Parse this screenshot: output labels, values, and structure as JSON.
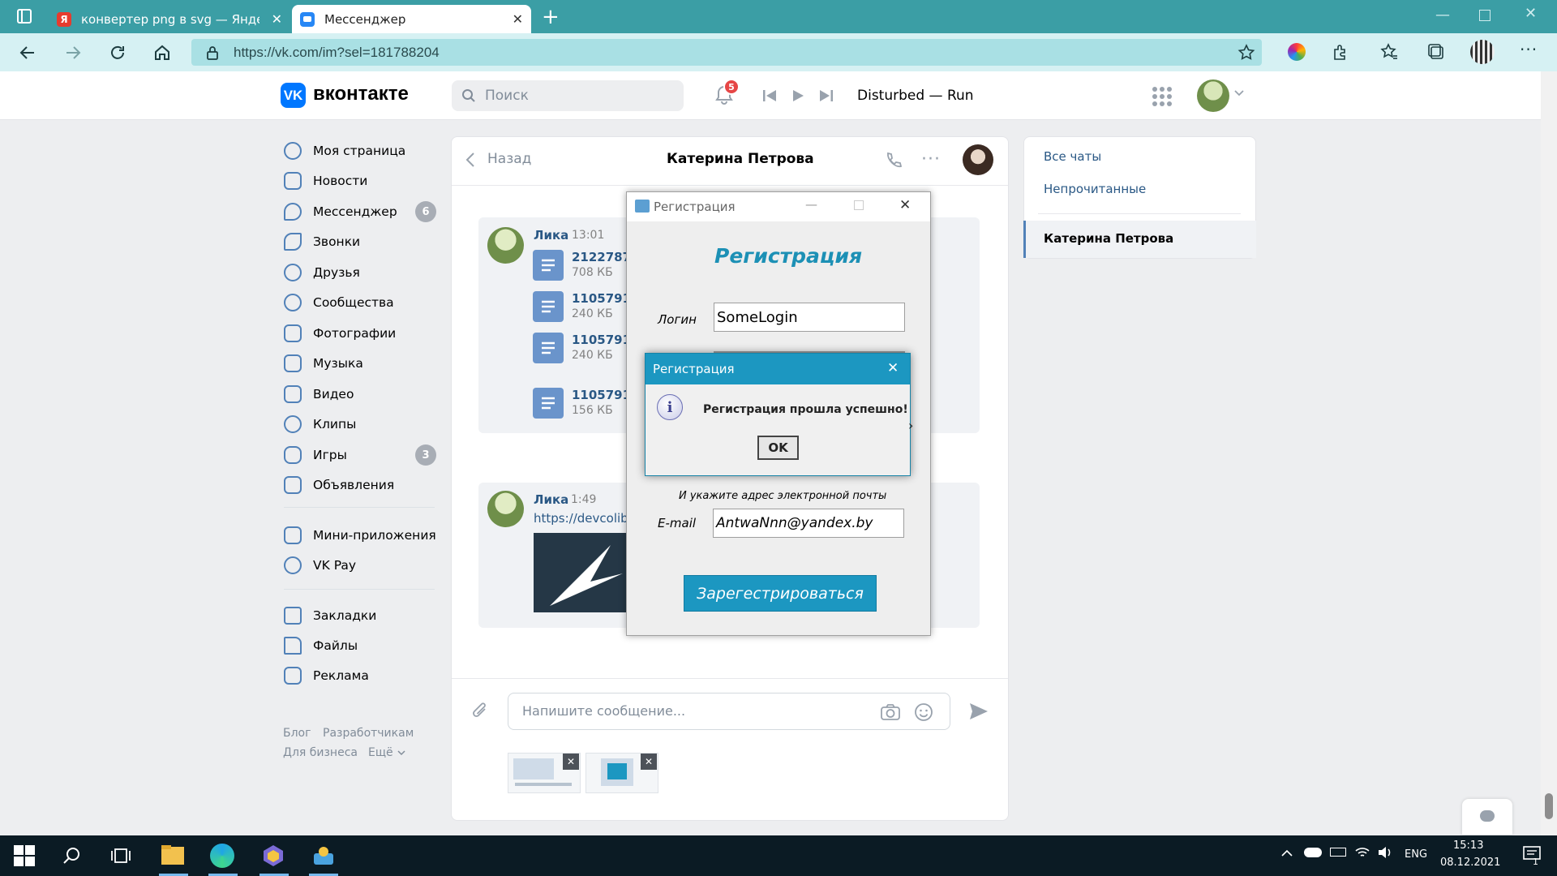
{
  "browser": {
    "tabs": [
      {
        "label": "конвертер png в svg — Яндекс",
        "favicon": "Я"
      },
      {
        "label": "Мессенджер",
        "favicon": "chat"
      }
    ],
    "url": "https://vk.com/im?sel=181788204"
  },
  "vk": {
    "logo_text": "вконтакте",
    "search_placeholder": "Поиск",
    "notifications_count": "5",
    "now_playing": "Disturbed — Run",
    "nav": [
      {
        "label": "Моя страница",
        "icon": "user-circle-icon"
      },
      {
        "label": "Новости",
        "icon": "news-icon"
      },
      {
        "label": "Мессенджер",
        "icon": "message-icon",
        "badge": "6"
      },
      {
        "label": "Звонки",
        "icon": "phone-icon"
      },
      {
        "label": "Друзья",
        "icon": "friends-icon"
      },
      {
        "label": "Сообщества",
        "icon": "groups-icon"
      },
      {
        "label": "Фотографии",
        "icon": "photo-icon"
      },
      {
        "label": "Музыка",
        "icon": "music-icon"
      },
      {
        "label": "Видео",
        "icon": "video-icon"
      },
      {
        "label": "Клипы",
        "icon": "clips-icon"
      },
      {
        "label": "Игры",
        "icon": "games-icon",
        "badge": "3"
      },
      {
        "label": "Объявления",
        "icon": "ads-icon"
      },
      {
        "label": "Мини-приложения",
        "icon": "apps-icon"
      },
      {
        "label": "VK Pay",
        "icon": "vkpay-icon"
      },
      {
        "label": "Закладки",
        "icon": "star-icon"
      },
      {
        "label": "Файлы",
        "icon": "file-icon"
      },
      {
        "label": "Реклама",
        "icon": "megaphone-icon"
      }
    ],
    "footer_links": [
      "Блог",
      "Разработчикам",
      "Для бизнеса",
      "Ещё"
    ],
    "chat": {
      "back_label": "Назад",
      "contact_name": "Катерина Петрова",
      "messages": [
        {
          "author": "Лика",
          "time": "13:01",
          "files": [
            {
              "name": "2122787_",
              "size": "708 КБ"
            },
            {
              "name": "1105791_",
              "size": "240 КБ"
            },
            {
              "name": "1105791_",
              "size": "240 КБ"
            },
            {
              "name": "1105791_",
              "size": "156 КБ"
            }
          ]
        },
        {
          "author": "Лика",
          "time": "1:49",
          "link": "https://devcolib"
        }
      ],
      "input_placeholder": "Напишите сообщение..."
    },
    "right_panel": {
      "items": [
        "Все чаты",
        "Непрочитанные"
      ],
      "active_chat": "Катерина Петрова"
    }
  },
  "reg_window": {
    "title": "Регистрация",
    "heading": "Регистрация",
    "login_label": "Логин",
    "login_value": "SomeLogin",
    "email_hint": "И укажите адрес электронной почты",
    "email_label": "E-mail",
    "email_value": "AntwaNnn@yandex.by",
    "submit_label": "Зарегестрироваться"
  },
  "dialog": {
    "title": "Регистрация",
    "message": "Регистрация прошла успешно!",
    "ok_label": "OK"
  },
  "taskbar": {
    "language": "ENG",
    "time": "15:13",
    "date": "08.12.2021",
    "notification_count": "1"
  },
  "colors": {
    "browser_accent": "#3b9ea5",
    "vk_blue": "#2a5885",
    "java_title": "#1c97c1",
    "reg_heading": "#1c90b5"
  }
}
